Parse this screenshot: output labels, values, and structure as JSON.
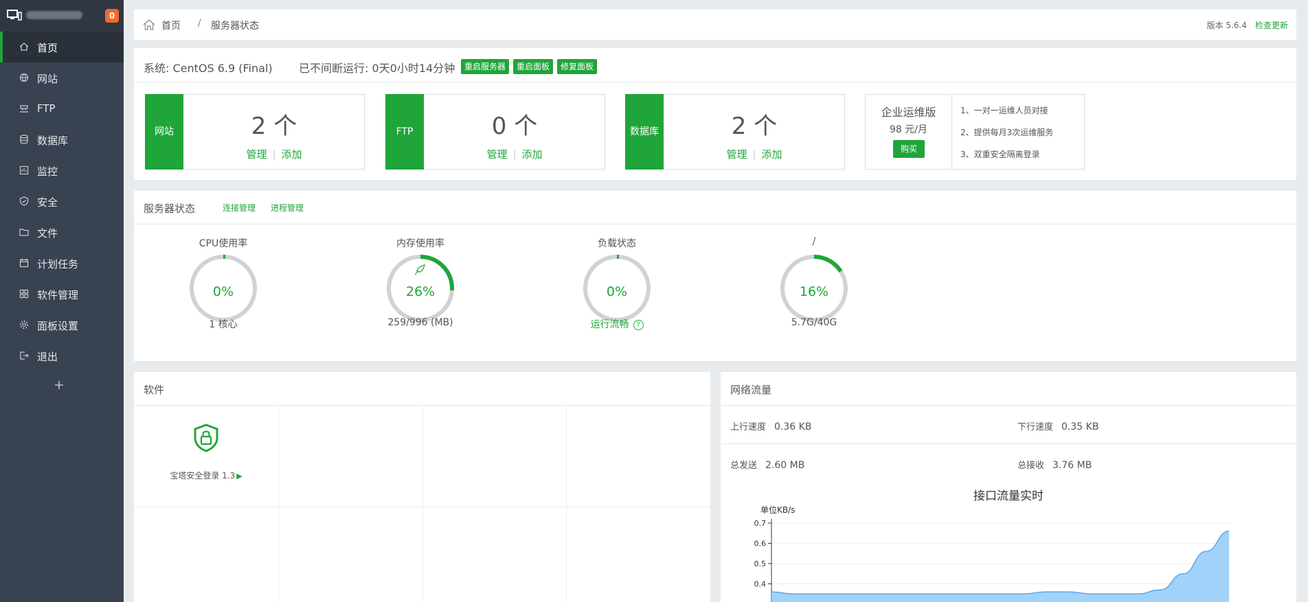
{
  "sidebar": {
    "badge": "0",
    "items": [
      {
        "label": "首页",
        "icon": "home-icon"
      },
      {
        "label": "网站",
        "icon": "globe-icon"
      },
      {
        "label": "FTP",
        "icon": "ftp-icon"
      },
      {
        "label": "数据库",
        "icon": "database-icon"
      },
      {
        "label": "监控",
        "icon": "monitor-icon"
      },
      {
        "label": "安全",
        "icon": "shield-icon"
      },
      {
        "label": "文件",
        "icon": "folder-icon"
      },
      {
        "label": "计划任务",
        "icon": "calendar-icon"
      },
      {
        "label": "软件管理",
        "icon": "grid-icon"
      },
      {
        "label": "面板设置",
        "icon": "gear-icon"
      },
      {
        "label": "退出",
        "icon": "logout-icon"
      }
    ]
  },
  "breadcrumb": {
    "home": "首页",
    "separator": "/",
    "current": "服务器状态"
  },
  "version": {
    "label": "版本 5.6.4",
    "check": "检查更新"
  },
  "system": {
    "os": "系统: CentOS 6.9 (Final)",
    "uptime": "已不间断运行: 0天0小时14分钟",
    "buttons": [
      "重启服务器",
      "重启面板",
      "修复面板"
    ]
  },
  "cards": [
    {
      "label": "网站",
      "count": "2 个",
      "manage": "管理",
      "add": "添加"
    },
    {
      "label": "FTP",
      "count": "0 个",
      "manage": "管理",
      "add": "添加"
    },
    {
      "label": "数据库",
      "count": "2 个",
      "manage": "管理",
      "add": "添加"
    }
  ],
  "enterprise": {
    "title": "企业运维版",
    "price": "98 元/月",
    "buy": "购买",
    "features": [
      "1、一对一运维人员对接",
      "2、提供每月3次运维服务",
      "3、双重安全隔离登录"
    ]
  },
  "status": {
    "title": "服务器状态",
    "links": [
      "连接管理",
      "进程管理"
    ],
    "gauges": [
      {
        "title": "CPU使用率",
        "value": "0%",
        "fraction": 0.0,
        "bottom": "1 核心"
      },
      {
        "title": "内存使用率",
        "value": "26%",
        "fraction": 0.26,
        "bottom": "259/996 (MB)"
      },
      {
        "title": "负载状态",
        "value": "0%",
        "fraction": 0.0,
        "bottom": "运行流畅"
      },
      {
        "title": "/",
        "value": "16%",
        "fraction": 0.16,
        "bottom": "5.7G/40G"
      }
    ]
  },
  "software": {
    "title": "软件",
    "apps": [
      {
        "name": "宝塔安全登录 1.3",
        "icon": "lock-shield-icon"
      }
    ]
  },
  "network": {
    "title": "网络流量",
    "up_label": "上行速度",
    "up_value": "0.36 KB",
    "down_label": "下行速度",
    "down_value": "0.35 KB",
    "sent_label": "总发送",
    "sent_value": "2.60 MB",
    "recv_label": "总接收",
    "recv_value": "3.76 MB"
  },
  "chart_data": {
    "type": "area",
    "title": "接口流量实时",
    "unit": "单位KB/s",
    "yticks": [
      "0.7",
      "0.6",
      "0.5",
      "0.4"
    ],
    "ylim": [
      0.3,
      0.7
    ],
    "series": [
      {
        "values": [
          0.36,
          0.35,
          0.35,
          0.35,
          0.35,
          0.35,
          0.35,
          0.35,
          0.35,
          0.35,
          0.35,
          0.35,
          0.36,
          0.36,
          0.35,
          0.35,
          0.35,
          0.37,
          0.45,
          0.56,
          0.66
        ]
      }
    ],
    "colors": [
      "#90caf9",
      "#63a4e8"
    ],
    "grid": true
  },
  "colors": {
    "accent": "#20a53a",
    "sidebar": "#384250",
    "badge": "#ef6a2c"
  }
}
